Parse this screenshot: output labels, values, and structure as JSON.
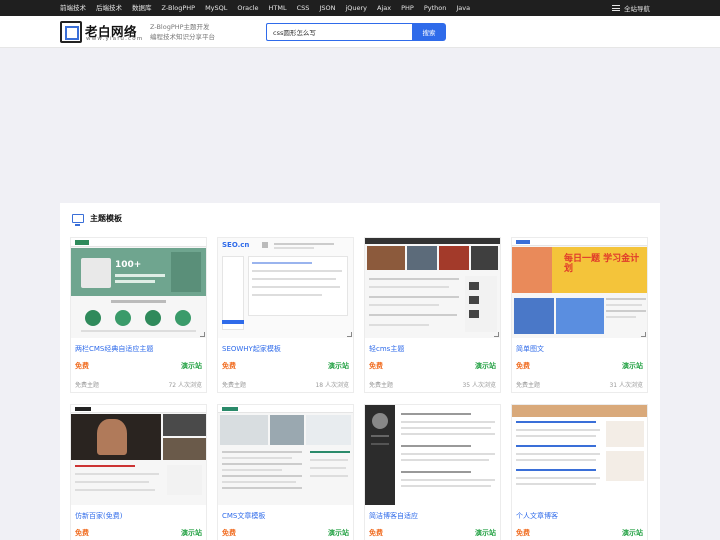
{
  "topnav": {
    "links": [
      "前端技术",
      "后端技术",
      "数据库",
      "Z-BlogPHP",
      "MySQL",
      "Oracle",
      "HTML",
      "CSS",
      "JSON",
      "jQuery",
      "Ajax",
      "PHP",
      "Python",
      "Java"
    ],
    "site_nav": "全站导航"
  },
  "header": {
    "logo_name": "老白网络",
    "logo_url": "www.yiafu.com",
    "slogan_line1": "Z-BlogPHP主题开发",
    "slogan_line2": "编程技术知识分享平台"
  },
  "search": {
    "value": "css圆形怎么写",
    "button": "搜索"
  },
  "section": {
    "title": "主题模板"
  },
  "cards": [
    {
      "title": "两栏CMS经典自适应主题",
      "price": "免费",
      "demo": "演示站",
      "category": "免费主题",
      "views": "72 人次浏览"
    },
    {
      "title": "SEOWHY起家模板",
      "price": "免费",
      "demo": "演示站",
      "category": "免费主题",
      "views": "18 人次浏览"
    },
    {
      "title": "轻cms主题",
      "price": "免费",
      "demo": "演示站",
      "category": "免费主题",
      "views": "35 人次浏览"
    },
    {
      "title": "简单图文",
      "price": "免费",
      "demo": "演示站",
      "category": "免费主题",
      "views": "31 人次浏览"
    },
    {
      "title": "仿新百家(免费)",
      "price": "免费",
      "demo": "演示站",
      "category": "",
      "views": ""
    },
    {
      "title": "CMS文章模板",
      "price": "免费",
      "demo": "演示站",
      "category": "",
      "views": ""
    },
    {
      "title": "简洁博客自适应",
      "price": "免费",
      "demo": "演示站",
      "category": "",
      "views": ""
    },
    {
      "title": "个人文章博客",
      "price": "免费",
      "demo": "演示站",
      "category": "",
      "views": ""
    }
  ],
  "thumb_text": {
    "t1_headline": "100+",
    "t2_logo": "SEO.cn",
    "t4_banner": "每日一题 学习金计划"
  },
  "colors": {
    "topbar": "#1f1f1f",
    "accent_blue": "#2f6bea",
    "price_orange": "#f06a1d",
    "demo_green": "#27a347"
  }
}
